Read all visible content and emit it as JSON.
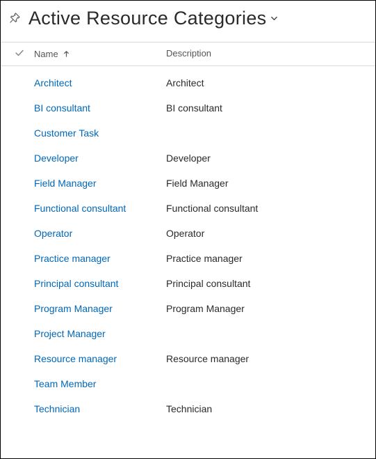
{
  "header": {
    "title": "Active Resource Categories"
  },
  "columns": {
    "name": "Name",
    "description": "Description"
  },
  "rows": [
    {
      "name": "Architect",
      "description": "Architect"
    },
    {
      "name": "BI consultant",
      "description": "BI consultant"
    },
    {
      "name": "Customer Task",
      "description": ""
    },
    {
      "name": "Developer",
      "description": "Developer"
    },
    {
      "name": "Field Manager",
      "description": "Field Manager"
    },
    {
      "name": "Functional consultant",
      "description": "Functional consultant"
    },
    {
      "name": "Operator",
      "description": "Operator"
    },
    {
      "name": "Practice manager",
      "description": "Practice manager"
    },
    {
      "name": "Principal consultant",
      "description": "Principal consultant"
    },
    {
      "name": "Program Manager",
      "description": "Program Manager"
    },
    {
      "name": "Project Manager",
      "description": ""
    },
    {
      "name": "Resource manager",
      "description": "Resource manager"
    },
    {
      "name": "Team Member",
      "description": ""
    },
    {
      "name": "Technician",
      "description": "Technician"
    }
  ]
}
